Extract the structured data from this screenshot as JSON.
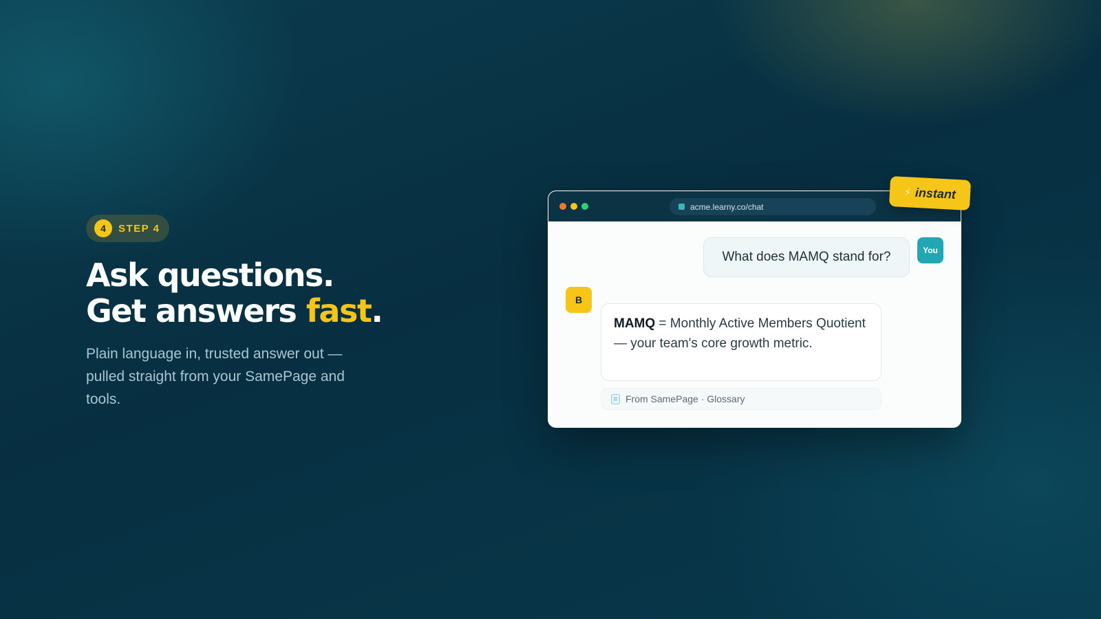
{
  "step": {
    "number": "4",
    "label": "STEP 4"
  },
  "headline": {
    "line1": "Ask questions.",
    "line2_prefix": "Get answers ",
    "line2_accent": "fast",
    "line2_suffix": "."
  },
  "subtext": "Plain language in, trusted answer out — pulled straight from your SamePage and tools.",
  "window": {
    "url": "acme.learny.co/chat",
    "user_message": "What does MAMQ stand for?",
    "user_avatar": "You",
    "bot_avatar": "B",
    "bot_term": "MAMQ",
    "bot_text": " = Monthly Active Members Quotient — your team's core growth metric.",
    "source": "From SamePage · Glossary"
  },
  "badge": {
    "icon": "⚡",
    "label": "instant"
  },
  "colors": {
    "accent": "#f5c518",
    "background": "#0b3c4e",
    "teal": "#22a6b3"
  },
  "icons": [
    "lock-icon",
    "doc-icon",
    "bolt-icon"
  ]
}
